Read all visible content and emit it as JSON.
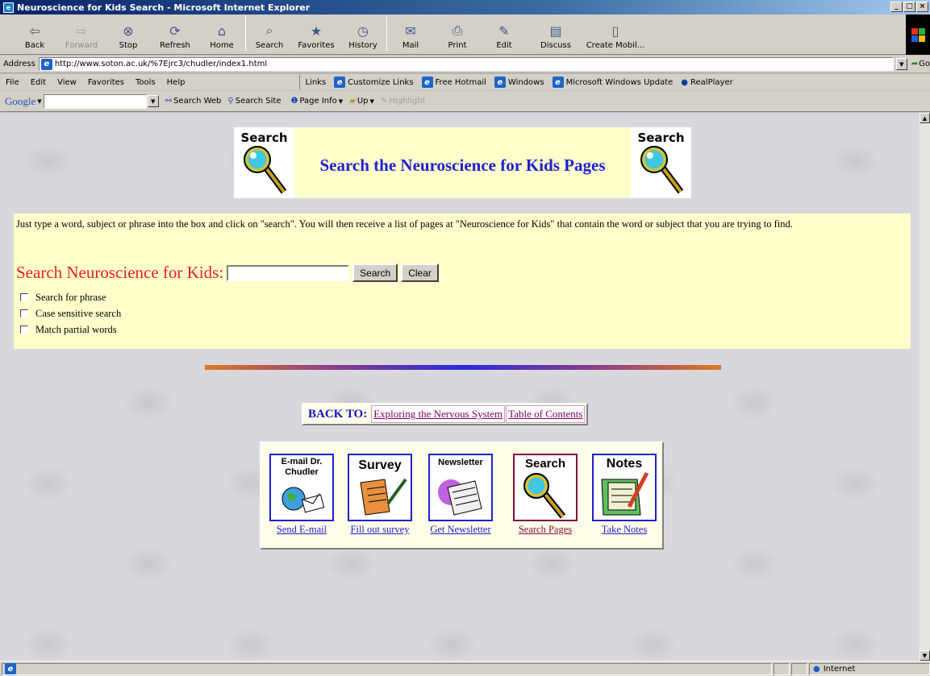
{
  "window": {
    "title": "Neuroscience for Kids Search - Microsoft Internet Explorer",
    "controls": [
      "_",
      "□",
      "×"
    ]
  },
  "toolbar": {
    "buttons": [
      {
        "label": "Back",
        "icon": "back-arrow-icon",
        "glyph": "⇦",
        "disabled": false
      },
      {
        "label": "Forward",
        "icon": "forward-arrow-icon",
        "glyph": "⇨",
        "disabled": true
      },
      {
        "label": "Stop",
        "icon": "stop-icon",
        "glyph": "⊗",
        "disabled": false
      },
      {
        "label": "Refresh",
        "icon": "refresh-icon",
        "glyph": "⟳",
        "disabled": false
      },
      {
        "label": "Home",
        "icon": "home-icon",
        "glyph": "⌂",
        "disabled": false
      },
      {
        "label": "Search",
        "icon": "search-icon",
        "glyph": "⌕",
        "disabled": false
      },
      {
        "label": "Favorites",
        "icon": "favorites-icon",
        "glyph": "★",
        "disabled": false
      },
      {
        "label": "History",
        "icon": "history-icon",
        "glyph": "◷",
        "disabled": false
      },
      {
        "label": "Mail",
        "icon": "mail-icon",
        "glyph": "✉",
        "disabled": false
      },
      {
        "label": "Print",
        "icon": "print-icon",
        "glyph": "⎙",
        "disabled": false
      },
      {
        "label": "Edit",
        "icon": "edit-icon",
        "glyph": "✎",
        "disabled": false
      },
      {
        "label": "Discuss",
        "icon": "discuss-icon",
        "glyph": "▤",
        "disabled": false
      },
      {
        "label": "Create Mobil...",
        "icon": "create-mobile-icon",
        "glyph": "▯",
        "disabled": false
      }
    ]
  },
  "address": {
    "label": "Address",
    "url": "http://www.soton.ac.uk/%7Ejrc3/chudler/index1.html",
    "go": "Go"
  },
  "menubar": {
    "items": [
      "File",
      "Edit",
      "View",
      "Favorites",
      "Tools",
      "Help"
    ]
  },
  "links_bar": {
    "label": "Links",
    "items": [
      "Customize Links",
      "Free Hotmail",
      "Windows",
      "Microsoft Windows Update",
      "RealPlayer"
    ]
  },
  "googlebar": {
    "logo": "Google",
    "search_web": "Search Web",
    "search_site": "Search Site",
    "page_info": "Page Info",
    "up": "Up",
    "highlight": "Highlight"
  },
  "page": {
    "banner_icon_label": "Search",
    "banner_title": "Search the Neuroscience for Kids Pages",
    "instructions": "Just type a word, subject or phrase into the box and click on \"search\". You will then receive a list of pages at \"Neuroscience for Kids\" that contain the word or subject that you are trying to find.",
    "search_label": "Search Neuroscience for Kids:",
    "search_value": "",
    "search_button": "Search",
    "clear_button": "Clear",
    "options": [
      "Search for phrase",
      "Case sensitive search",
      "Match partial words"
    ],
    "back_to_label": "BACK TO:",
    "back_links": [
      "Exploring the Nervous System",
      "Table of Contents"
    ],
    "nav": [
      {
        "title": "E-mail Dr. Chudler",
        "link": "Send E-mail",
        "icon": "email-globe-icon"
      },
      {
        "title": "Survey",
        "link": "Fill out survey",
        "icon": "survey-scroll-icon"
      },
      {
        "title": "Newsletter",
        "link": "Get Newsletter",
        "icon": "newspaper-icon"
      },
      {
        "title": "Search",
        "link": "Search Pages",
        "icon": "magnifier-icon"
      },
      {
        "title": "Notes",
        "link": "Take Notes",
        "icon": "notes-pencil-icon"
      }
    ]
  },
  "status": {
    "left": "",
    "zone": "Internet"
  },
  "colors": {
    "banner_title": "#2020d0",
    "search_label": "#e82020",
    "panel_bg": "#ffffcc",
    "link": "#2020d0",
    "visited_link": "#800060"
  }
}
